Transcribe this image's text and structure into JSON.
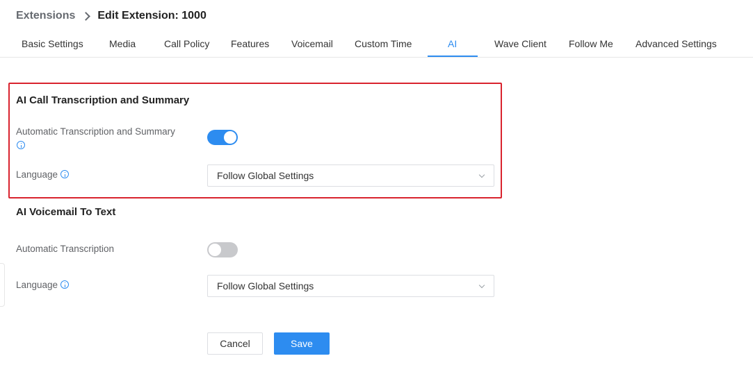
{
  "breadcrumb": {
    "parent": "Extensions",
    "current": "Edit Extension: 1000"
  },
  "tabs": [
    {
      "label": "Basic Settings",
      "active": false
    },
    {
      "label": "Media",
      "active": false
    },
    {
      "label": "Call Policy",
      "active": false
    },
    {
      "label": "Features",
      "active": false
    },
    {
      "label": "Voicemail",
      "active": false
    },
    {
      "label": "Custom Time",
      "active": false
    },
    {
      "label": "AI",
      "active": true
    },
    {
      "label": "Wave Client",
      "active": false
    },
    {
      "label": "Follow Me",
      "active": false
    },
    {
      "label": "Advanced Settings",
      "active": false
    }
  ],
  "call_section": {
    "title": "AI Call Transcription and Summary",
    "auto_label": "Automatic Transcription and Summary",
    "auto_enabled": true,
    "language_label": "Language",
    "language_value": "Follow Global Settings"
  },
  "voicemail_section": {
    "title": "AI Voicemail To Text",
    "auto_label": "Automatic Transcription",
    "auto_enabled": false,
    "language_label": "Language",
    "language_value": "Follow Global Settings"
  },
  "actions": {
    "cancel_label": "Cancel",
    "save_label": "Save"
  },
  "colors": {
    "accent": "#2d8cf0",
    "highlight_border": "#d9232e",
    "toggle_off": "#c8c9cc"
  }
}
